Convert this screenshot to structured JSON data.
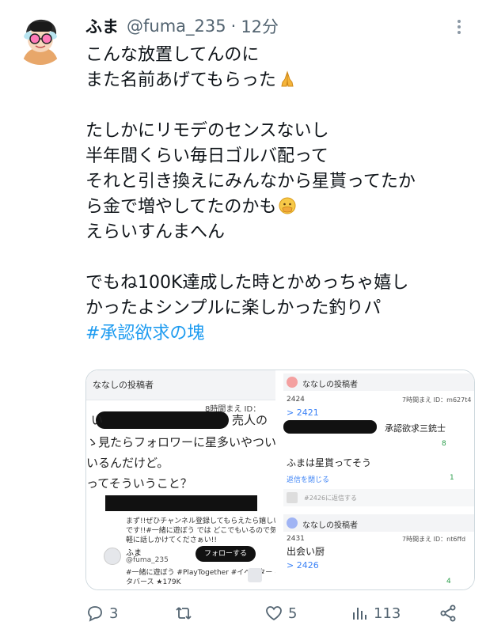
{
  "tweet": {
    "display_name": "ふま",
    "handle": "@fuma_235",
    "separator": "·",
    "time": "12分",
    "lines": [
      "こんな放置してんのに",
      "また名前あげてもらった",
      "",
      "たしかにリモデのセンスないし",
      "半年間くらい毎日ゴルバ配って",
      "それと引き換えにみんなから星貰ってたか",
      "ら金で増やしてたのかも",
      "えらいすんまへん",
      "",
      "でもね100K達成した時とかめっちゃ嬉し",
      "かったよシンプルに楽しかった釣りパ"
    ],
    "hashtag": "#承認欲求の塊"
  },
  "media": {
    "left": {
      "header": "ななしの投稿者",
      "meta": "8時間まえ ID：",
      "text1_suffix": "売人の",
      "lines": [
        "ゝ見たらフォロワーに星多いやつい",
        "いるんだけど。",
        "ってそういうこと？"
      ],
      "card_text_1": "まず!!ぜひチャンネル登録してもらえたら嬉しい",
      "card_text_2": "です!!#一緒に遊ぼう では どこでもいるので気",
      "card_text_3": "軽に話しかけてくださぁい!!",
      "card_name": "ふま",
      "card_handle": "@fuma_235",
      "follow_label": "フォローする",
      "card_tags_1": "#一緒に遊ぼう #PlayTogether #イベンター #メ",
      "card_tags_2": "タバース ★179K"
    },
    "right": {
      "header_1": "ななしの投稿者",
      "num_1": "2424",
      "meta_1": "7時間まえ ID：m627t4",
      "link_1": "> 2421",
      "title_1": "承認欲求三銃士",
      "like_1": "8",
      "text_2": "ふまは星貰ってそう",
      "reply_toggle": "返信を閉じる",
      "like_2": "1",
      "reply_placeholder": "#2426に返信する",
      "header_2": "ななしの投稿者",
      "num_2": "2431",
      "meta_2": "7時間まえ ID：nt6ffd",
      "text_3": "出会い厨",
      "link_2": "> 2426",
      "like_3": "4"
    }
  },
  "actions": {
    "replies": "3",
    "retweets": "",
    "likes": "5",
    "views": "113"
  },
  "colors": {
    "text": "#0f1419",
    "secondary": "#536471",
    "link": "#1d9bf0"
  }
}
